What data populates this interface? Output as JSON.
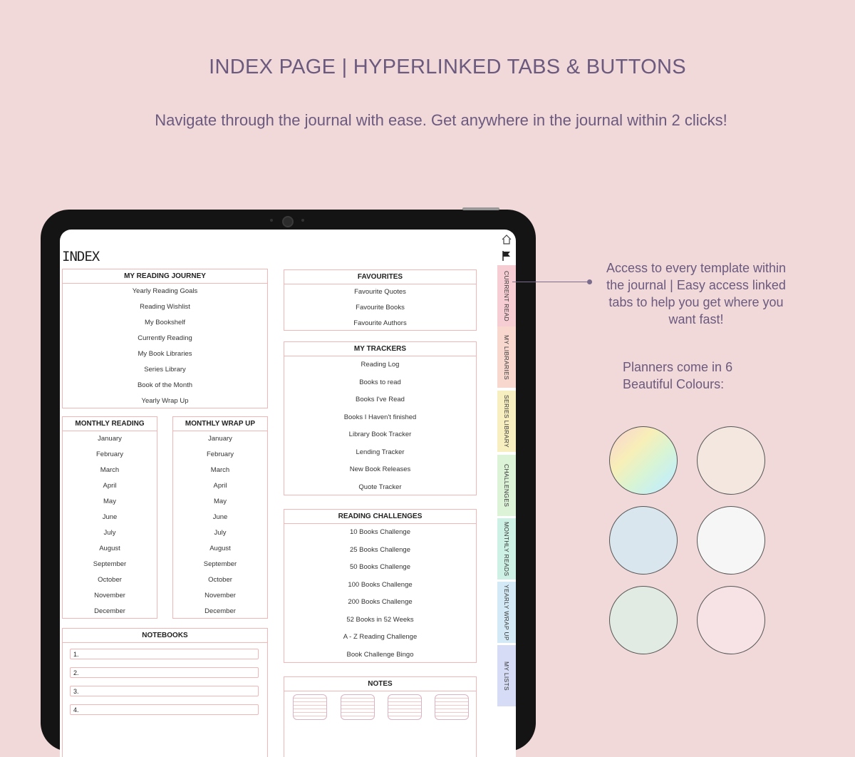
{
  "headline": "INDEX PAGE | HYPERLINKED TABS & BUTTONS",
  "subline": "Navigate through the journal with ease. Get anywhere in the journal within 2 clicks!",
  "callout": "Access to every template within the journal | Easy access linked tabs to help you get where you want fast!",
  "colors_text": {
    "line1": "Planners come in 6",
    "line2": "Beautiful Colours:"
  },
  "swatches": [
    {
      "name": "rainbow",
      "color": "#f7f0b8"
    },
    {
      "name": "beige",
      "color": "#f3e7df"
    },
    {
      "name": "blue",
      "color": "#d9e6ee"
    },
    {
      "name": "white",
      "color": "#f6f6f6"
    },
    {
      "name": "sage",
      "color": "#e2ebe3"
    },
    {
      "name": "pink",
      "color": "#f7e3e5"
    }
  ],
  "screen": {
    "title": "INDEX",
    "journey": {
      "header": "MY READING JOURNEY",
      "items": [
        "Yearly Reading Goals",
        "Reading Wishlist",
        "My Bookshelf",
        "Currently Reading",
        "My Book Libraries",
        "Series Library",
        "Book of the Month",
        "Yearly Wrap Up"
      ]
    },
    "favourites": {
      "header": "FAVOURITES",
      "items": [
        "Favourite Quotes",
        "Favourite Books",
        "Favourite Authors"
      ]
    },
    "trackers": {
      "header": "MY TRACKERS",
      "items": [
        "Reading Log",
        "Books to read",
        "Books I've Read",
        "Books I Haven't finished",
        "Library Book Tracker",
        "Lending Tracker",
        "New Book Releases",
        "Quote Tracker"
      ]
    },
    "monthly_reading": {
      "header": "MONTHLY READING",
      "items": [
        "January",
        "February",
        "March",
        "April",
        "May",
        "June",
        "July",
        "August",
        "September",
        "October",
        "November",
        "December"
      ]
    },
    "monthly_wrap": {
      "header": "MONTHLY WRAP UP",
      "items": [
        "January",
        "February",
        "March",
        "April",
        "May",
        "June",
        "July",
        "August",
        "September",
        "October",
        "November",
        "December"
      ]
    },
    "challenges": {
      "header": "READING CHALLENGES",
      "items": [
        "10 Books Challenge",
        "25 Books Challenge",
        "50 Books Challenge",
        "100 Books Challenge",
        "200 Books Challenge",
        "52 Books in 52 Weeks",
        "A - Z Reading Challenge",
        "Book Challenge Bingo"
      ]
    },
    "notebooks": {
      "header": "NOTEBOOKS",
      "items": [
        "1.",
        "2.",
        "3.",
        "4."
      ]
    },
    "notes": {
      "header": "NOTES"
    },
    "tabs": [
      {
        "label": "CURRENT READ",
        "color": "#f6cdd2"
      },
      {
        "label": "MY LIBRARIES",
        "color": "#f8d7cf"
      },
      {
        "label": "SERIES LIBRARY",
        "color": "#f8efc0"
      },
      {
        "label": "CHALLENGES",
        "color": "#dcf3d8"
      },
      {
        "label": "MONTHLY READS",
        "color": "#cdf1e4"
      },
      {
        "label": "YEARLY WRAP UP",
        "color": "#d3eaf6"
      },
      {
        "label": "MY LISTS",
        "color": "#d6dcf5"
      }
    ]
  }
}
